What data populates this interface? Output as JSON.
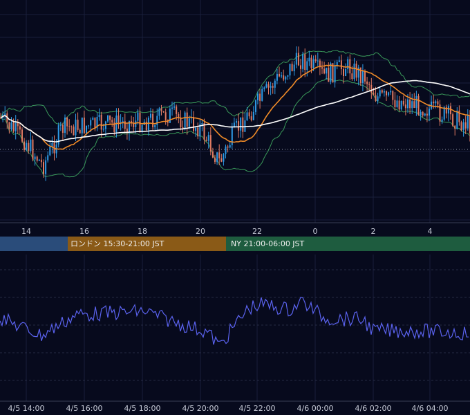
{
  "chart_data": [
    {
      "type": "candlestick",
      "title": "",
      "indicators": {
        "bollinger_bands": true,
        "moving_average_fast_color": "#f28c28",
        "moving_average_slow_color": "#ffffff"
      },
      "x_tick_labels": [
        "14",
        "16",
        "18",
        "20",
        "22",
        "0",
        "2",
        "4"
      ],
      "colors": {
        "up": "#2e9be6",
        "down": "#e07a62",
        "bands": "#3a9a5a"
      },
      "grid": true,
      "reference_line": "dotted"
    },
    {
      "type": "line",
      "title": "",
      "x_tick_labels": [
        "4/5 14:00",
        "4/5 16:00",
        "4/5 18:00",
        "4/5 20:00",
        "4/5 22:00",
        "4/6 00:00",
        "4/6 02:00",
        "4/6 04:00"
      ],
      "series_color": "#5b63f0",
      "grid": true
    }
  ],
  "sessions": {
    "tokyo": "",
    "london": "ロンドン 15:30-21:00 JST",
    "ny": "NY 21:00-06:00 JST"
  },
  "colors": {
    "background": "#070a1d",
    "grid": "#1a1f3a",
    "tokyo": "#2a4c7a",
    "london": "#8a5a17",
    "ny": "#1e5c3f"
  }
}
